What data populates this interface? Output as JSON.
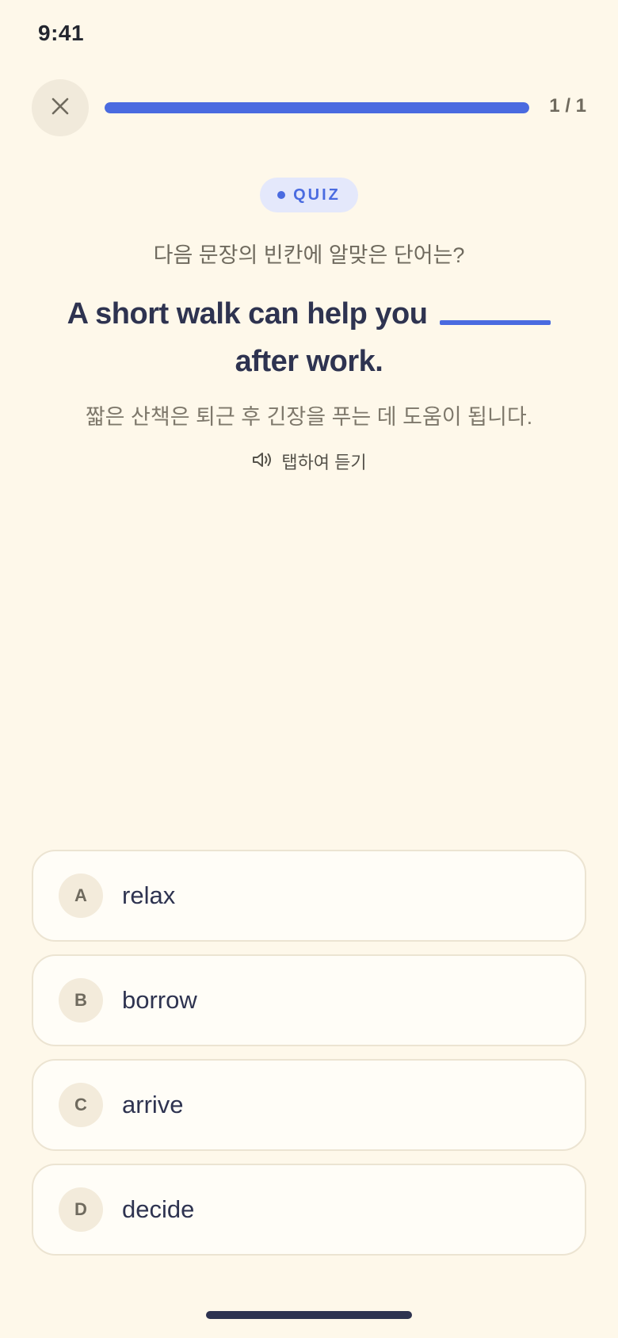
{
  "status_bar": {
    "time": "9:41"
  },
  "header": {
    "close_icon": "close-icon",
    "progress_fraction": 1.0,
    "progress_text": "1 / 1"
  },
  "quiz": {
    "badge_label": "QUIZ",
    "prompt": "다음 문장의 빈칸에 알맞은 단어는?",
    "sentence_before": "A short walk can help you",
    "sentence_after": "after work.",
    "translation": "짧은 산책은 퇴근 후 긴장을 푸는 데 도움이 됩니다.",
    "listen_icon": "speaker-icon",
    "listen_label": "탭하여 듣기"
  },
  "options": [
    {
      "letter": "A",
      "text": "relax"
    },
    {
      "letter": "B",
      "text": "borrow"
    },
    {
      "letter": "C",
      "text": "arrive"
    },
    {
      "letter": "D",
      "text": "decide"
    }
  ],
  "colors": {
    "accent": "#4A6BE0",
    "background": "#FEF8EA",
    "text_dark": "#2E3350"
  }
}
